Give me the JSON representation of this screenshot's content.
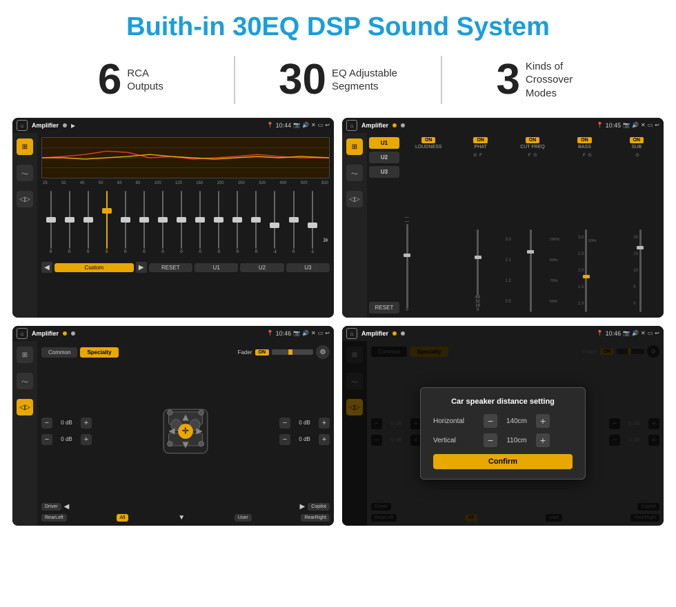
{
  "page": {
    "title": "Buith-in 30EQ DSP Sound System"
  },
  "stats": [
    {
      "number": "6",
      "label_line1": "RCA",
      "label_line2": "Outputs"
    },
    {
      "number": "30",
      "label_line1": "EQ Adjustable",
      "label_line2": "Segments"
    },
    {
      "number": "3",
      "label_line1": "Kinds of",
      "label_line2": "Crossover Modes"
    }
  ],
  "screens": [
    {
      "title": "Amplifier",
      "time": "10:44",
      "description": "EQ Sliders screen"
    },
    {
      "title": "Amplifier",
      "time": "10:45",
      "description": "Crossover controls screen"
    },
    {
      "title": "Amplifier",
      "time": "10:46",
      "description": "Speaker positioning screen"
    },
    {
      "title": "Amplifier",
      "time": "10:46",
      "description": "Speaker distance dialog screen"
    }
  ],
  "dialog": {
    "title": "Car speaker distance setting",
    "horizontal_label": "Horizontal",
    "horizontal_value": "140cm",
    "vertical_label": "Vertical",
    "vertical_value": "110cm",
    "confirm_label": "Confirm"
  },
  "eq": {
    "frequencies": [
      "25",
      "32",
      "40",
      "50",
      "63",
      "80",
      "100",
      "125",
      "160",
      "200",
      "250",
      "320",
      "400",
      "500",
      "630"
    ],
    "values": [
      "0",
      "0",
      "0",
      "5",
      "0",
      "0",
      "0",
      "0",
      "0",
      "0",
      "0",
      "0",
      "-1",
      "0",
      "-1"
    ],
    "preset_label": "Custom",
    "reset_label": "RESET",
    "buttons": [
      "U1",
      "U2",
      "U3"
    ]
  },
  "s2": {
    "presets": [
      "U1",
      "U2",
      "U3"
    ],
    "controls": [
      "LOUDNESS",
      "PHAT",
      "CUT FREQ",
      "BASS",
      "SUB"
    ],
    "reset_label": "RESET"
  },
  "s3": {
    "tabs": [
      "Common",
      "Specialty"
    ],
    "fader_label": "Fader",
    "on_label": "ON",
    "bottom_labels": [
      "Driver",
      "Copilot",
      "RearLeft",
      "All",
      "User",
      "RearRight"
    ]
  }
}
